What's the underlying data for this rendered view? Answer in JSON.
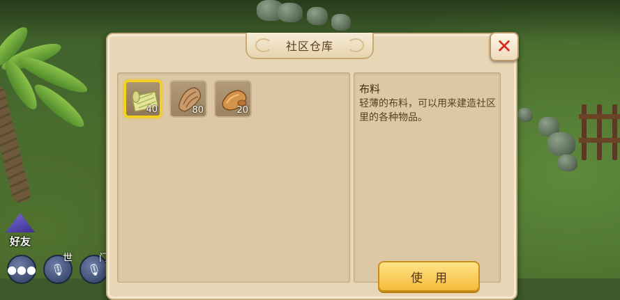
{
  "dialog": {
    "title": "社区仓库",
    "close_symbol": "✕"
  },
  "inventory": {
    "items": [
      {
        "icon": "blueprint-icon",
        "count": "40",
        "selected": true
      },
      {
        "icon": "cloth-icon",
        "count": "80",
        "selected": false
      },
      {
        "icon": "wood-icon",
        "count": "20",
        "selected": false
      }
    ]
  },
  "detail": {
    "name": "布料",
    "description": "轻薄的布料，可以用来建造社区里的各种物品。",
    "use_label": "使用"
  },
  "hud": {
    "friends_label": "好友",
    "world_label": "世",
    "partial_label": "门"
  },
  "colors": {
    "selected_border": "#f6d21a",
    "close_x": "#d8281c",
    "use_button": "#f4bc3a"
  }
}
